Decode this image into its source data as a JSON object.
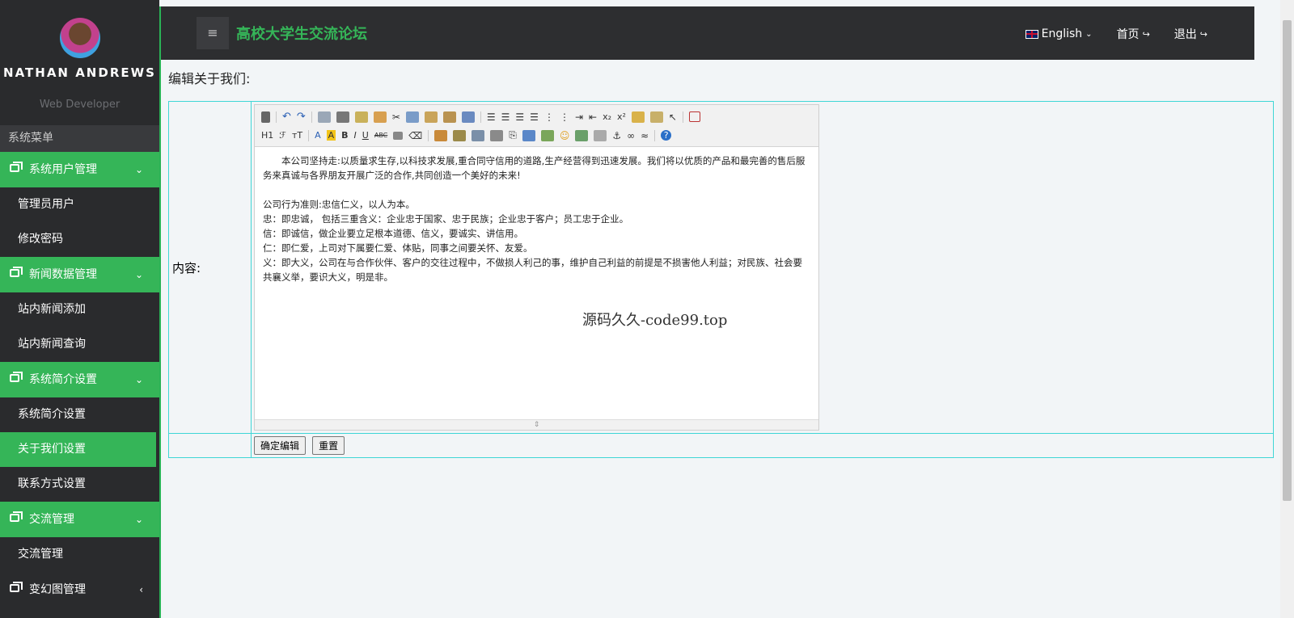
{
  "profile": {
    "name": "NATHAN ANDREWS",
    "role": "Web Developer"
  },
  "sidebar": {
    "menu_title": "系统菜单",
    "groups": [
      {
        "label": "系统用户管理",
        "chevron": "⌄",
        "items": [
          "管理员用户",
          "修改密码"
        ]
      },
      {
        "label": "新闻数据管理",
        "chevron": "⌄",
        "items": [
          "站内新闻添加",
          "站内新闻查询"
        ]
      },
      {
        "label": "系统简介设置",
        "chevron": "⌄",
        "items": [
          "系统简介设置",
          "关于我们设置",
          "联系方式设置"
        ]
      },
      {
        "label": "交流管理",
        "chevron": "⌄",
        "items": [
          "交流管理"
        ]
      },
      {
        "label": "变幻图管理",
        "chevron": "‹",
        "items": []
      }
    ],
    "active_item": "关于我们设置"
  },
  "topbar": {
    "title": "高校大学生交流论坛",
    "hamburger": "≡",
    "language": "English",
    "home": "首页",
    "logout": "退出"
  },
  "page": {
    "heading": "编辑关于我们:",
    "content_label": "内容:",
    "toolbar_row2_labels": [
      "H1",
      "ℱ",
      "тT",
      "A",
      "A",
      "B",
      "I",
      "U",
      "ABC"
    ],
    "editor_paragraphs": [
      "本公司坚持走:以质量求生存,以科技求发展,重合同守信用的道路,生产经营得到迅速发展。我们将以优质的产品和最完善的售后服务来真诚与各界朋友开展广泛的合作,共同创造一个美好的未来!",
      "",
      "公司行为准则:忠信仁义，以人为本。",
      "忠：即忠诚， 包括三重含义：企业忠于国家、忠于民族；企业忠于客户；员工忠于企业。",
      "信：即诚信，做企业要立足根本道德、信义，要诚实、讲信用。",
      "仁：即仁爱，上司对下属要仁爱、体贴，同事之间要关怀、友爱。",
      "义：即大义，公司在与合作伙伴、客户的交往过程中，不做损人利己的事，维护自己利益的前提是不损害他人利益；对民族、社会要共襄义举，要识大义，明是非。"
    ],
    "watermark": "源码久久-code99.top",
    "submit_label": "确定编辑",
    "reset_label": "重置"
  }
}
